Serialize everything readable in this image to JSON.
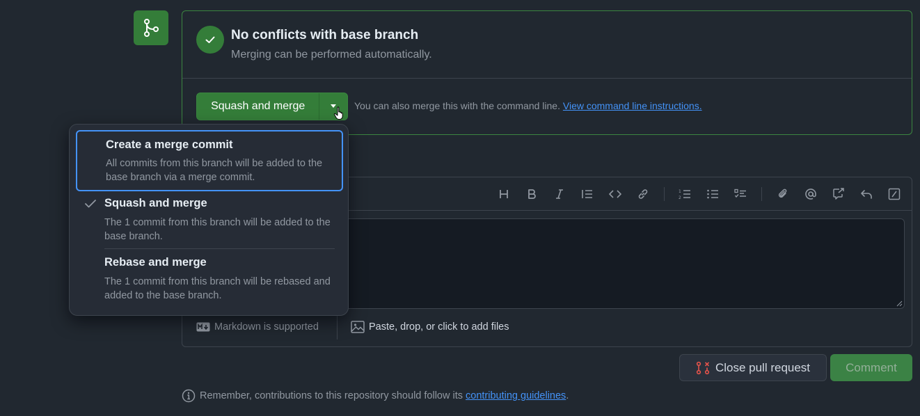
{
  "colors": {
    "background": "#212830",
    "success": "#347d39",
    "link": "#4493f8",
    "focus": "#4493f8",
    "danger": "#e5534b"
  },
  "merge_status": {
    "title": "No conflicts with base branch",
    "subtitle": "Merging can be performed automatically.",
    "icon": "check-icon"
  },
  "merge_actions": {
    "main_button_label": "Squash and merge",
    "caret_icon": "triangle-down-icon",
    "cmdline_note": "You can also merge this with the command line.",
    "cmdline_link": "View command line instructions."
  },
  "merge_menu": {
    "items": [
      {
        "title": "Create a merge commit",
        "description": "All commits from this branch will be added to the base branch via a merge commit.",
        "selected": false,
        "focused": true
      },
      {
        "title": "Squash and merge",
        "description": "The 1 commit from this branch will be added to the base branch.",
        "selected": true,
        "focused": false
      },
      {
        "title": "Rebase and merge",
        "description": "The 1 commit from this branch will be rebased and added to the base branch.",
        "selected": false,
        "focused": false
      }
    ]
  },
  "editor": {
    "toolbar": [
      "heading-icon",
      "bold-icon",
      "italic-icon",
      "quote-icon",
      "code-icon",
      "link-icon",
      "ordered-list-icon",
      "unordered-list-icon",
      "task-list-icon",
      "attachment-icon",
      "mention-icon",
      "reference-icon",
      "reply-icon",
      "slash-command-icon"
    ],
    "markdown_hint": "Markdown is supported",
    "attach_hint": "Paste, drop, or click to add files"
  },
  "footer": {
    "close_pr_label": "Close pull request",
    "comment_label": "Comment",
    "reminder_text": "Remember, contributions to this repository should follow its",
    "guidelines_link": "contributing guidelines",
    "reminder_end": "."
  }
}
